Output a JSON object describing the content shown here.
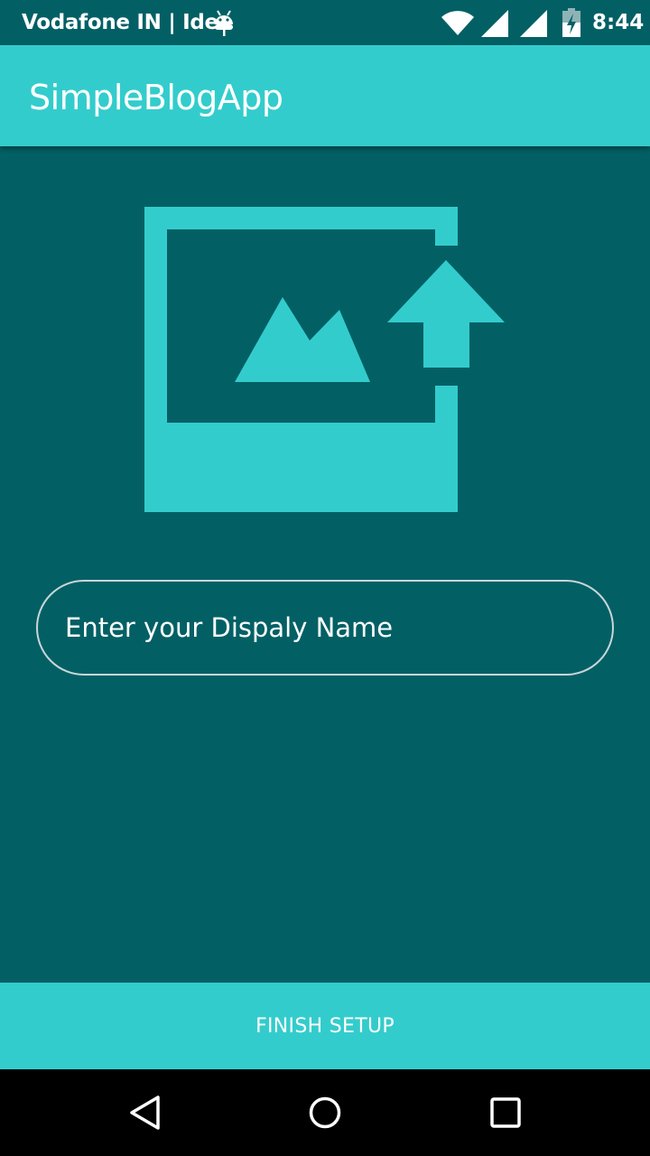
{
  "status_bar": {
    "carrier": "Vodafone IN | Idea",
    "time": "8:44",
    "icons": [
      "android-debug-icon",
      "wifi-icon",
      "signal-icon",
      "signal-icon",
      "battery-charging-icon"
    ]
  },
  "app_bar": {
    "title": "SimpleBlogApp"
  },
  "profile_setup": {
    "image_icon": "add-photo-upload-icon",
    "name_input": {
      "placeholder": "Enter your Dispaly Name",
      "value": ""
    },
    "finish_label": "FINISH SETUP"
  },
  "nav_bar": {
    "icons": [
      "back-icon",
      "home-icon",
      "recents-icon"
    ]
  },
  "colors": {
    "background": "#026065",
    "accent": "#33CCCC",
    "text": "#FFFFFF",
    "nav_bar": "#000000"
  }
}
